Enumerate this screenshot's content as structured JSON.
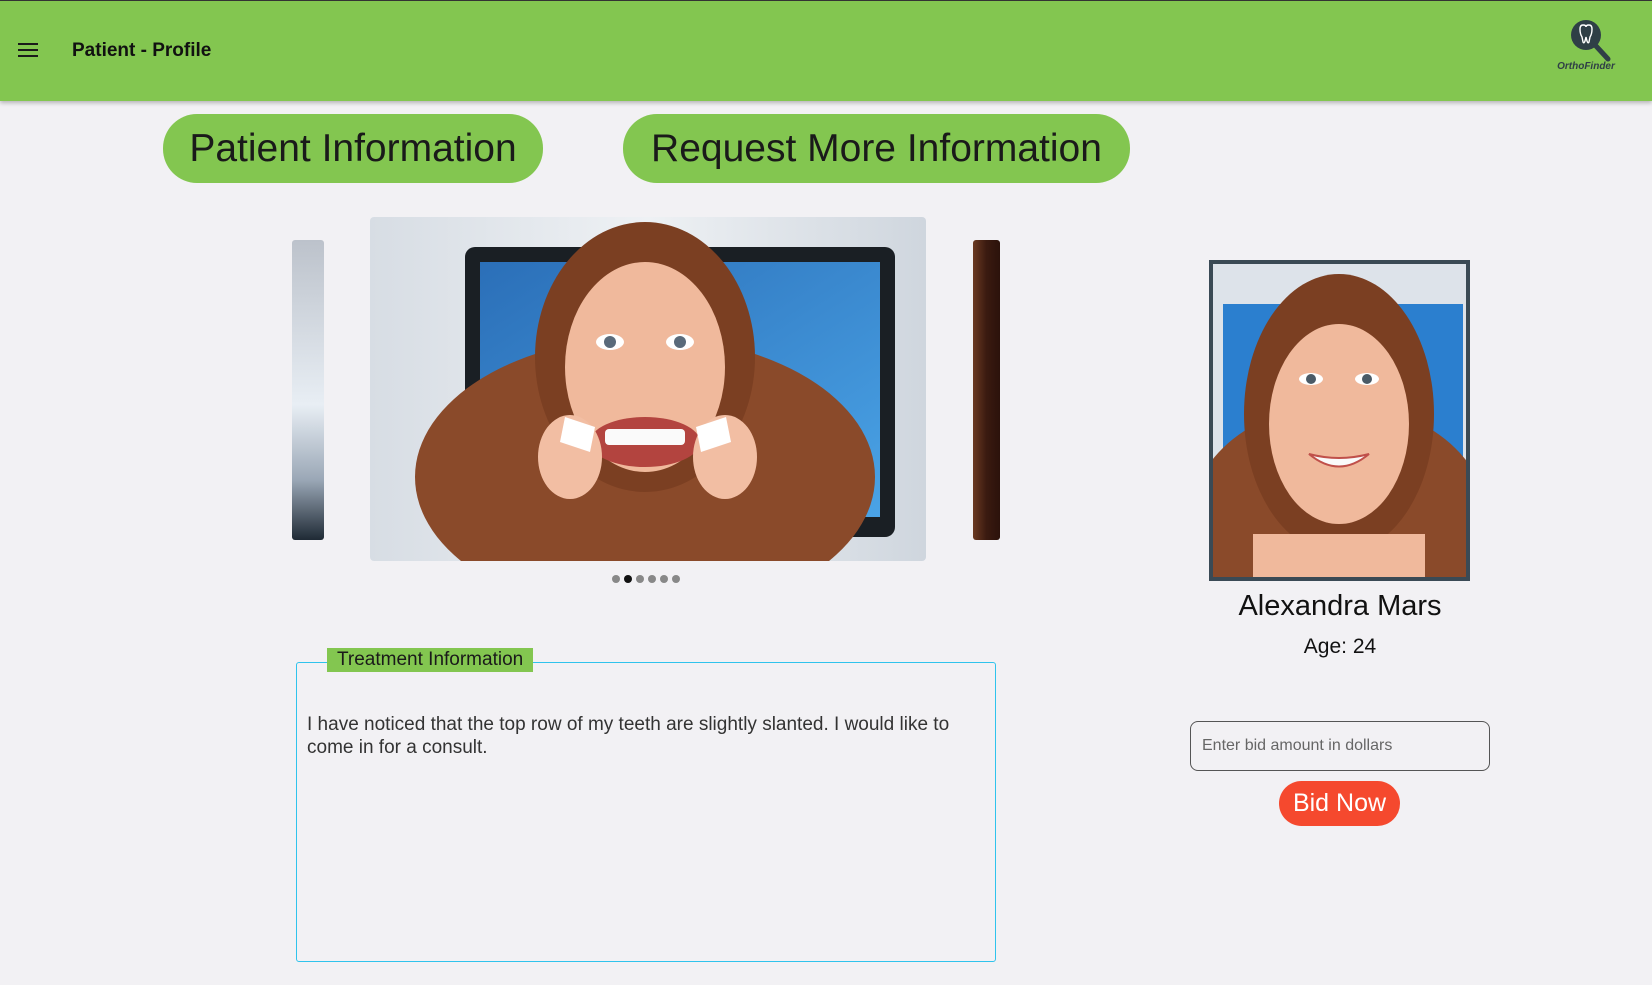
{
  "header": {
    "title": "Patient - Profile",
    "logo_text": "OrthoFinder",
    "color": "#83c650"
  },
  "nav_buttons": {
    "patient_info": "Patient Information",
    "request_info": "Request More Information"
  },
  "carousel": {
    "slide_count": 6,
    "active_index": 1
  },
  "treatment": {
    "legend": "Treatment Information",
    "text": "I have noticed that the top row of my teeth are slightly slanted. I would like to come in for a consult."
  },
  "profile": {
    "name": "Alexandra Mars",
    "age_label": "Age: 24"
  },
  "bid": {
    "placeholder": "Enter bid amount in dollars",
    "button_label": "Bid Now",
    "button_color": "#f5492e"
  }
}
